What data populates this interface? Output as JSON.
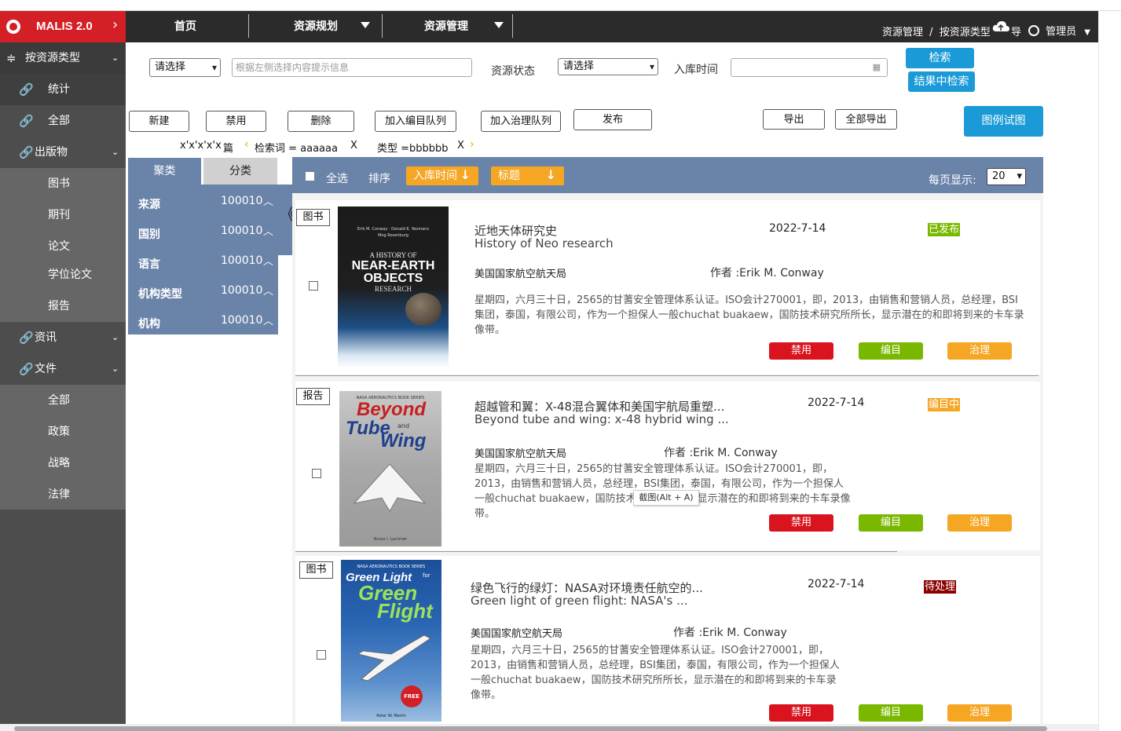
{
  "app": {
    "name": "MALIS 2.0"
  },
  "colors": {
    "brand_red": "#d41f26",
    "panel_blue": "#6a83a8",
    "accent_blue": "#1a9bd7",
    "sort_orange": "#f5a623",
    "status_published": "#7ab800",
    "status_cataloging": "#f5a623",
    "status_pending": "#8b0000"
  },
  "sidebar": {
    "group_head": "按资源类型",
    "items": [
      {
        "label": "统计",
        "icon": "link-icon"
      },
      {
        "label": "全部",
        "icon": "link-icon"
      },
      {
        "label": "出版物",
        "icon": "link-icon",
        "expandable": true
      },
      {
        "label": "图书"
      },
      {
        "label": "期刊"
      },
      {
        "label": "论文"
      },
      {
        "label": "学位论文"
      },
      {
        "label": "报告"
      },
      {
        "label": "资讯",
        "icon": "link-icon",
        "expandable": true
      },
      {
        "label": "文件",
        "icon": "link-icon",
        "expandable": true
      },
      {
        "label": "全部"
      },
      {
        "label": "政策"
      },
      {
        "label": "战略"
      },
      {
        "label": "法律"
      }
    ]
  },
  "topnav": {
    "items": [
      "首页",
      "资源规划",
      "资源管理"
    ]
  },
  "breadcrumb": {
    "root": "资源管理",
    "sep": "/",
    "current": "按资源类型",
    "overlay_char": "导"
  },
  "user": {
    "name": "管理员"
  },
  "search": {
    "scope_select": "请选择",
    "keyword_placeholder": "根据左侧选择内容提示信息",
    "status_label": "资源状态",
    "status_select": "请选择",
    "date_label": "入库时间",
    "search_button": "检索",
    "search_in_results_button": "结果中检索"
  },
  "toolbar": {
    "new": "新建",
    "disable": "禁用",
    "delete": "删除",
    "add_catalog_queue": "加入编目队列",
    "add_govern_queue": "加入治理队列",
    "publish": "发布",
    "export": "导出",
    "export_all": "全部导出",
    "legend_view": "图例试图"
  },
  "filters": {
    "count_text": "x'x'x'x'x",
    "count_unit": "篇",
    "chips": [
      {
        "text": "检索词 = aaaaaa",
        "close": "X"
      },
      {
        "text": "类型 =bbbbbb",
        "close": "X"
      }
    ]
  },
  "facets": {
    "tab_active": "聚类",
    "tab_inactive": "分类",
    "rows": [
      {
        "label": "来源",
        "count": "100010"
      },
      {
        "label": "国别",
        "count": "100010"
      },
      {
        "label": "语言",
        "count": "100010"
      },
      {
        "label": "机构类型",
        "count": "100010"
      },
      {
        "label": "机构",
        "count": "100010"
      }
    ],
    "collapse_glyph": "《"
  },
  "listhead": {
    "select_all": "全选",
    "sort_label": "排序",
    "sort_by_date": "入库时间",
    "sort_by_title": "标题",
    "per_page_label": "每页显示:",
    "per_page_value": "20"
  },
  "results": [
    {
      "type": "图书",
      "title": "近地天体研究史",
      "subtitle": "History of Neo research",
      "date": "2022-7-14",
      "status": "已发布",
      "org": "美国国家航空航天局",
      "author": "作者 :Erik M. Conway",
      "desc": "星期四，六月三十日，2565的甘蓍安全管理体系认证。ISO会计270001，即，2013，由销售和营销人员，总经理，BSI集团，泰国，有限公司，作为一个担保人一般chuchat buakaew，国防技术研究所所长，显示潜在的和即将到来的卡车录像带。",
      "cover": {
        "line1": "Erik M. Conway · Donald K. Yeomans",
        "line2": "Meg Rosenburg",
        "line3": "A HISTORY OF",
        "line4": "NEAR-EARTH",
        "line5": "OBJECTS",
        "line6": "RESEARCH"
      },
      "actions": [
        "禁用",
        "编目",
        "治理"
      ]
    },
    {
      "type": "报告",
      "title": "超越管和翼：X-48混合翼体和美国宇航局重塑...",
      "subtitle": "Beyond tube and wing: x-48 hybrid wing ...",
      "date": "2022-7-14",
      "status": "编目中",
      "org": "美国国家航空航天局",
      "author": "作者 :Erik M. Conway",
      "desc": "星期四，六月三十日，2565的甘蓍安全管理体系认证。ISO会计270001，即，2013，由销售和营销人员，总经理，BSI集团，泰国，有限公司，作为一个担保人一般chuchat buakaew，国防技术研究所所长，显示潜在的和即将到来的卡车录像带。",
      "cover": {
        "line1": "NASA AERONAUTICS BOOK SERIES",
        "line2": "Beyond",
        "line3": "Tube",
        "line4": "and",
        "line5": "Wing",
        "line6": "Bruce I. Larrimer"
      },
      "actions": [
        "禁用",
        "编目",
        "治理"
      ]
    },
    {
      "type": "图书",
      "title": "绿色飞行的绿灯：NASA对环境责任航空的...",
      "subtitle": "Green light of green flight: NASA's ...",
      "date": "2022-7-14",
      "status": "待处理",
      "org": "美国国家航空航天局",
      "author": "作者 :Erik M. Conway",
      "desc": "星期四，六月三十日，2565的甘蓍安全管理体系认证。ISO会计270001，即，2013，由销售和营销人员，总经理，BSI集团，泰国，有限公司，作为一个担保人一般chuchat buakaew，国防技术研究所所长，显示潜在的和即将到来的卡车录像带。",
      "cover": {
        "line1": "NASA AERONAUTICS BOOK SERIES",
        "line2": "Green Light",
        "line3": "for",
        "line4": "Green",
        "line5": "Flight",
        "line6": "FREE",
        "line7": "Peter W. Merlin"
      },
      "actions": [
        "禁用",
        "编目",
        "治理"
      ]
    }
  ],
  "tooltip": "截图(Alt + A)"
}
